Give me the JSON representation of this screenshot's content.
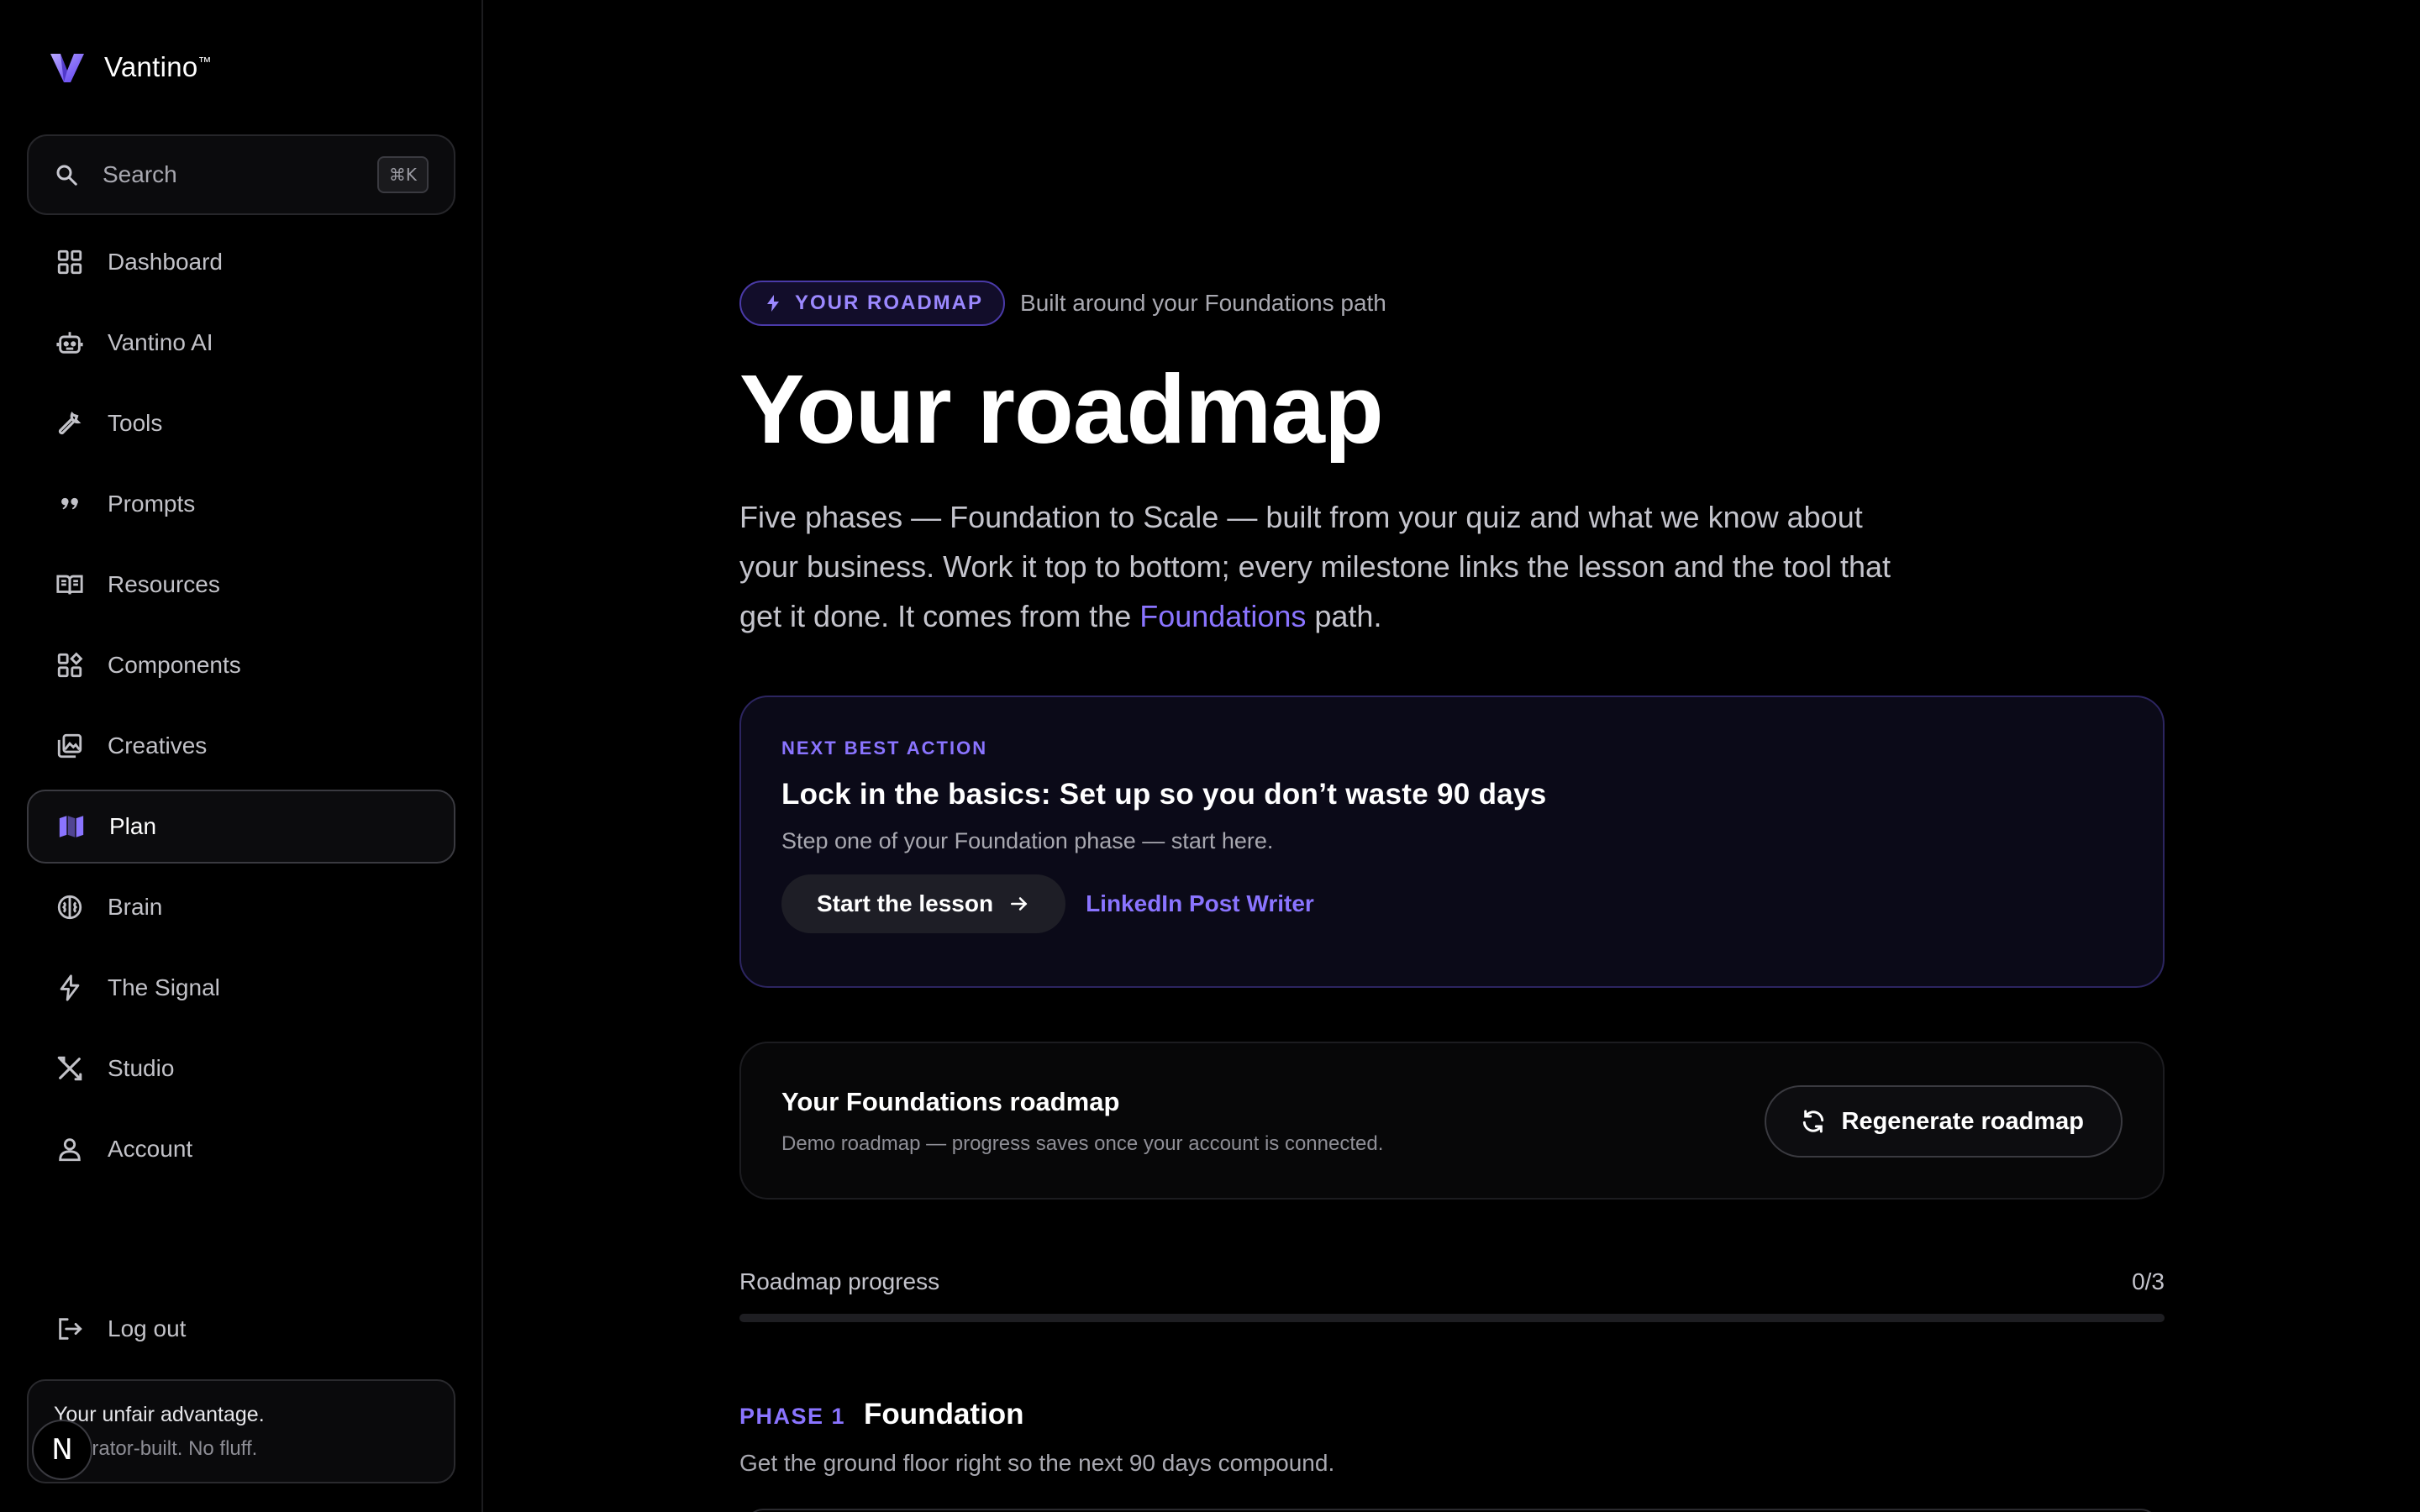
{
  "brand": {
    "name": "Vantino",
    "tm": "™"
  },
  "search": {
    "placeholder": "Search",
    "shortcut": "⌘K"
  },
  "sidebar": {
    "items": [
      {
        "label": "Dashboard",
        "icon": "grid-icon"
      },
      {
        "label": "Vantino AI",
        "icon": "robot-icon"
      },
      {
        "label": "Tools",
        "icon": "wrench-icon"
      },
      {
        "label": "Prompts",
        "icon": "quote-icon"
      },
      {
        "label": "Resources",
        "icon": "book-icon"
      },
      {
        "label": "Components",
        "icon": "shapes-icon"
      },
      {
        "label": "Creatives",
        "icon": "image-stack-icon"
      },
      {
        "label": "Plan",
        "icon": "map-icon",
        "active": true
      },
      {
        "label": "Brain",
        "icon": "brain-icon"
      },
      {
        "label": "The Signal",
        "icon": "bolt-icon"
      },
      {
        "label": "Studio",
        "icon": "tools-cross-icon"
      },
      {
        "label": "Account",
        "icon": "user-icon"
      }
    ],
    "logout": "Log out",
    "promo": {
      "line1": "Your unfair advantage.",
      "line2": "Operator-built. No fluff."
    },
    "badge": "N"
  },
  "main": {
    "pill": "YOUR ROADMAP",
    "pill_sub": "Built around your Foundations path",
    "title": "Your roadmap",
    "desc_before": "Five phases — Foundation to Scale — built from your quiz and what we know about your business. Work it top to bottom; every milestone links the lesson and the tool that get it done. It comes from the ",
    "desc_link": "Foundations",
    "desc_after": " path.",
    "next_action": {
      "label": "NEXT BEST ACTION",
      "title": "Lock in the basics: Set up so you don’t waste 90 days",
      "sub": "Step one of your Foundation phase — start here.",
      "button": "Start the lesson",
      "tool_link": "LinkedIn Post Writer"
    },
    "roadmap_card": {
      "title": "Your Foundations roadmap",
      "sub": "Demo roadmap — progress saves once your account is connected.",
      "button": "Regenerate roadmap"
    },
    "progress": {
      "label": "Roadmap progress",
      "count": "0/3",
      "fraction": 0
    },
    "phase": {
      "number": "PHASE 1",
      "name": "Foundation",
      "desc": "Get the ground floor right so the next 90 days compound."
    }
  },
  "colors": {
    "accent": "#8a74ff",
    "background": "#000000"
  }
}
